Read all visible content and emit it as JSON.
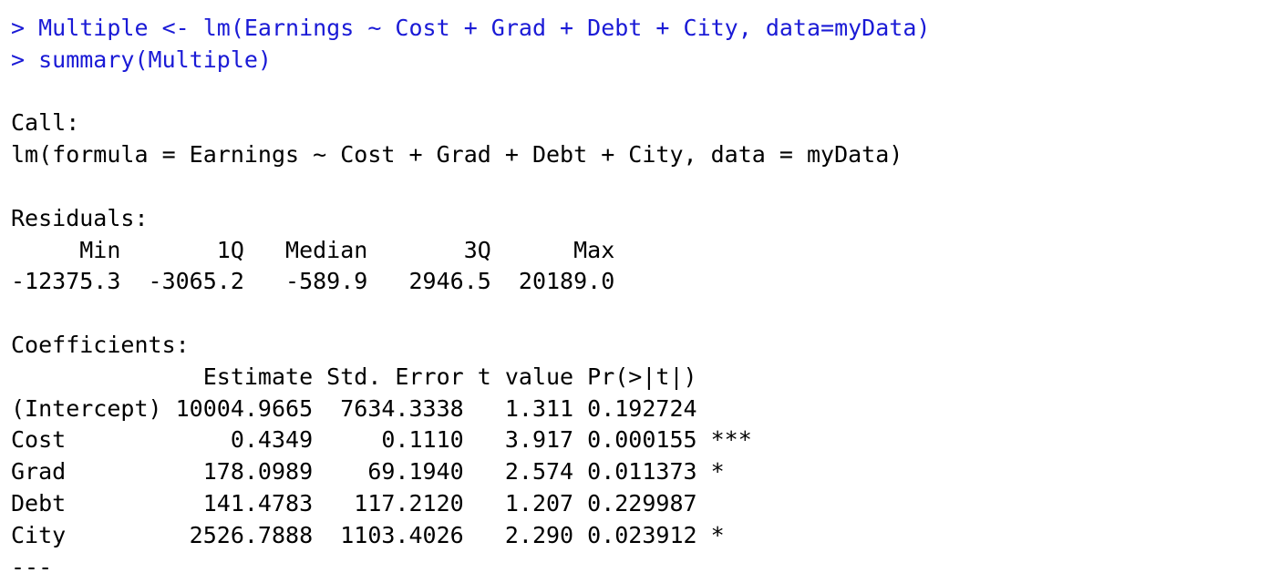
{
  "console": {
    "commands": [
      "> Multiple <- lm(Earnings ~ Cost + Grad + Debt + City, data=myData)",
      "> summary(Multiple)"
    ],
    "call_header": "Call:",
    "call_formula": "lm(formula = Earnings ~ Cost + Grad + Debt + City, data = myData)",
    "residuals_header": "Residuals:",
    "residuals_labels": "     Min       1Q   Median       3Q      Max ",
    "residuals_values": "-12375.3  -3065.2   -589.9   2946.5  20189.0 ",
    "coefficients_header": "Coefficients:",
    "coef_columns": "              Estimate Std. Error t value Pr(>|t|)    ",
    "coef_rows": [
      "(Intercept) 10004.9665  7634.3338   1.311 0.192724    ",
      "Cost            0.4349     0.1110   3.917 0.000155 ***",
      "Grad          178.0989    69.1940   2.574 0.011373 *  ",
      "Debt          141.4783   117.2120   1.207 0.229987    ",
      "City         2526.7888  1103.4026   2.290 0.023912 *  "
    ],
    "separator": "---"
  },
  "colors": {
    "command_text": "#1a1ad6",
    "output_text": "#000000",
    "background": "#ffffff"
  }
}
